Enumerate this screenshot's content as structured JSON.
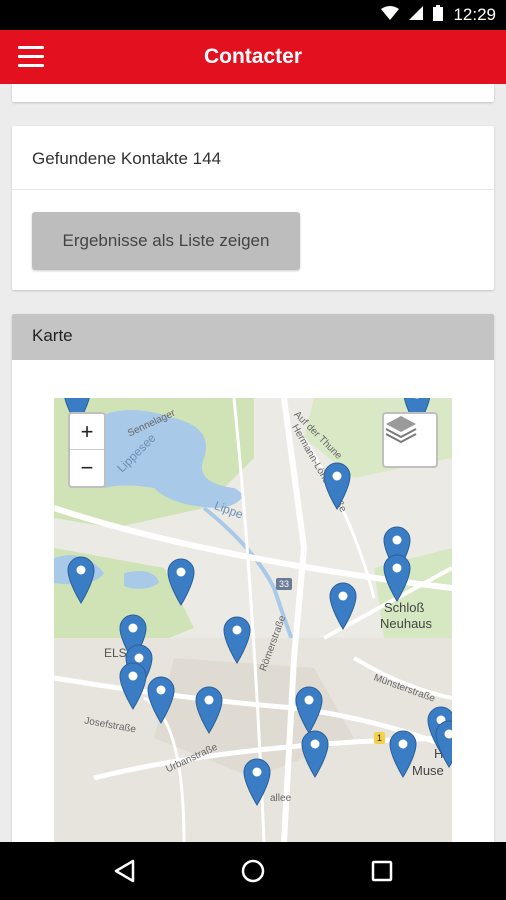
{
  "status": {
    "time": "12:29"
  },
  "app_bar": {
    "title": "Contacter"
  },
  "results": {
    "count_text": "Gefundene Kontakte 144",
    "button_label": "Ergebnisse als Liste zeigen"
  },
  "map_card": {
    "header": "Karte",
    "zoom_in": "+",
    "zoom_out": "−",
    "labels": {
      "lippesee": "Lippesee",
      "lippe": "Lippe",
      "sennelager": "Sennelager",
      "hermann": "Hermann-Löns-Straße",
      "thune": "Auf der Thune",
      "roemer": "Römerstraße",
      "muenster": "Münsterstraße",
      "schloss_1": "Schloß",
      "schloss_2": "Neuhaus",
      "els": "ELS",
      "josef": "Josefstraße",
      "urban": "Urbanstraße",
      "allee": "allee",
      "hu": "H",
      "muse": "Muse",
      "road_33": "33",
      "road_1": "1"
    },
    "marker_count": 24
  },
  "colors": {
    "accent": "#e3111f",
    "marker": "#3b7dc4"
  },
  "icons": [
    "menu-icon",
    "wifi-icon",
    "signal-icon",
    "battery-icon",
    "layers-icon",
    "back-icon",
    "home-icon",
    "recents-icon",
    "map-marker-icon"
  ]
}
